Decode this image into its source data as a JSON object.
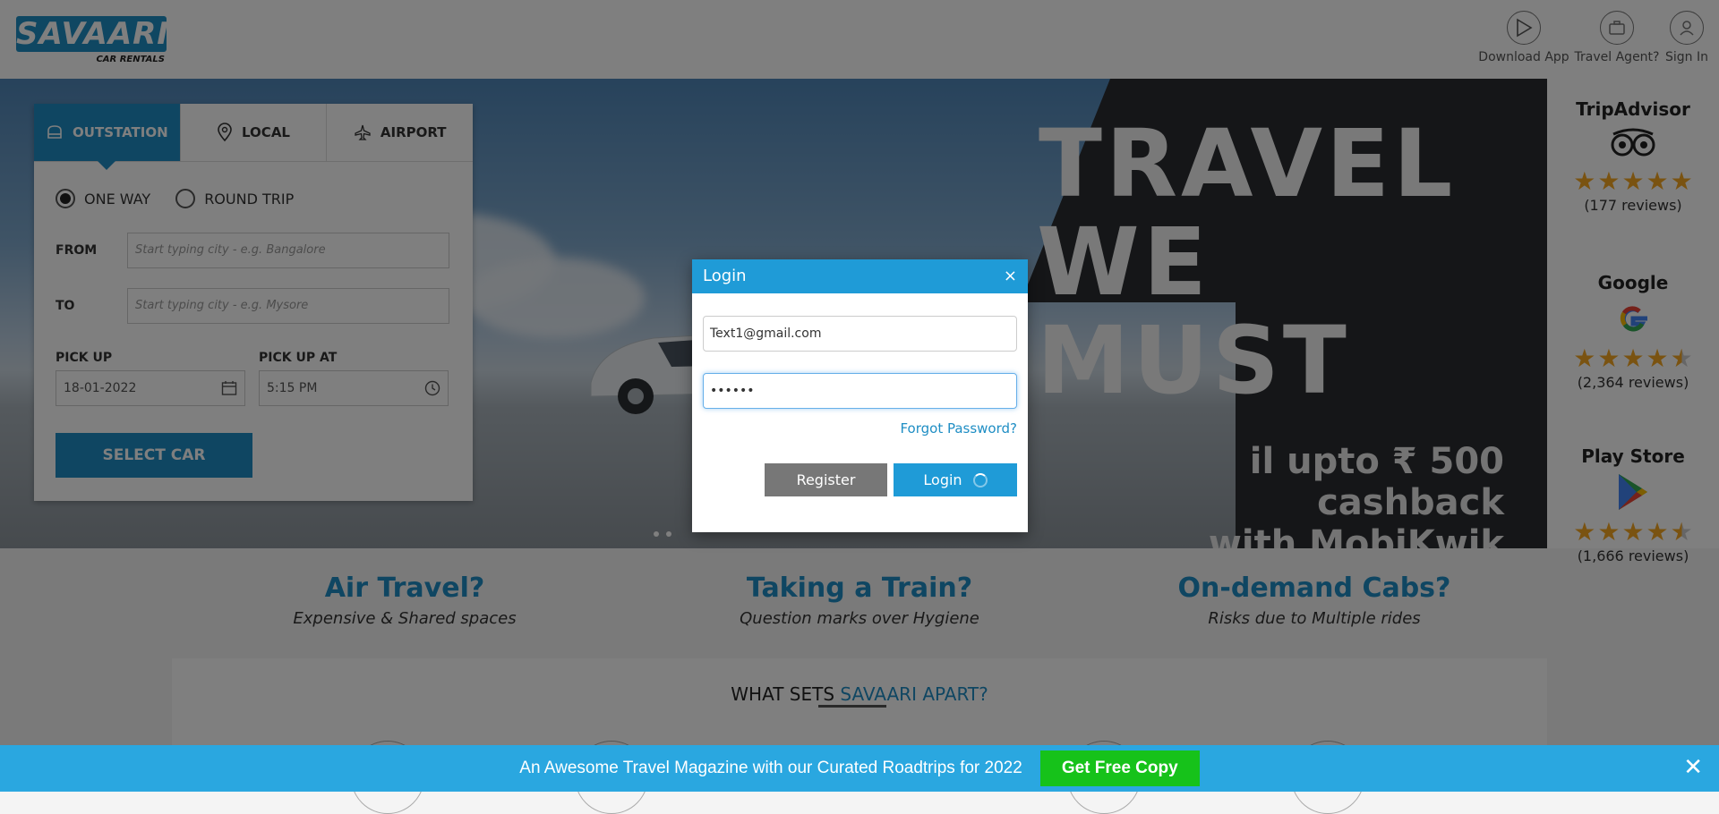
{
  "header": {
    "logo_main": "SAVAARI",
    "logo_sub": "CAR RENTALS",
    "actions": [
      {
        "label": "Download App",
        "icon": "play-store-icon"
      },
      {
        "label": "Travel Agent?",
        "icon": "briefcase-icon"
      },
      {
        "label": "Sign In",
        "icon": "user-icon"
      }
    ]
  },
  "hero": {
    "headline_line1": "TRAVEL",
    "headline_line2": "WE MUST",
    "cashback_line1": "il upto ₹ 500 cashback",
    "cashback_line2": "with MobiKwik"
  },
  "booking": {
    "tabs": [
      {
        "label": "OUTSTATION",
        "icon": "car-seat-icon",
        "active": true
      },
      {
        "label": "LOCAL",
        "icon": "location-pin-icon",
        "active": false
      },
      {
        "label": "AIRPORT",
        "icon": "airplane-icon",
        "active": false
      }
    ],
    "trip_types": [
      {
        "label": "ONE WAY",
        "selected": true
      },
      {
        "label": "ROUND TRIP",
        "selected": false
      }
    ],
    "from_label": "FROM",
    "from_placeholder": "Start typing city - e.g. Bangalore",
    "to_label": "TO",
    "to_placeholder": "Start typing city - e.g. Mysore",
    "pickup_label": "PICK UP",
    "pickup_value": "18-01-2022",
    "pickup_at_label": "PICK UP AT",
    "pickup_at_value": "5:15 PM",
    "select_car_label": "SELECT CAR"
  },
  "reviews": [
    {
      "source": "TripAdvisor",
      "rating": 5,
      "count": "(177 reviews)",
      "icon": "tripadvisor-icon"
    },
    {
      "source": "Google",
      "rating": 4.5,
      "count": "(2,364 reviews)",
      "icon": "google-icon"
    },
    {
      "source": "Play Store",
      "rating": 4.5,
      "count": "(1,666 reviews)",
      "icon": "play-store-icon"
    }
  ],
  "features": [
    {
      "title": "Air Travel?",
      "subtitle": "Expensive & Shared spaces"
    },
    {
      "title": "Taking a Train?",
      "subtitle": "Question marks over Hygiene"
    },
    {
      "title": "On-demand Cabs?",
      "subtitle": "Risks due to Multiple rides"
    }
  ],
  "sets_apart": {
    "prefix": "WHAT SETS ",
    "highlight": "SAVAARI APART?"
  },
  "login_modal": {
    "title": "Login",
    "close": "×",
    "email_value": "Text1@gmail.com",
    "password_value": "••••••",
    "forgot_label": "Forgot Password?",
    "register_label": "Register",
    "login_label": "Login"
  },
  "promo_bar": {
    "text": "An Awesome Travel Magazine with our Curated Roadtrips for 2022",
    "button_label": "Get Free Copy",
    "close": "✕"
  },
  "colors": {
    "brand_blue": "#1f9bd7",
    "promo_green": "#16c21a",
    "star_gold": "#f5a623"
  }
}
